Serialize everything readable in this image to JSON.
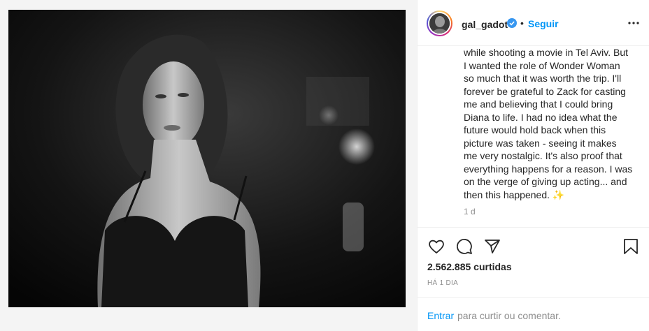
{
  "post": {
    "image_alt_icon": "portrait-photo",
    "username": "gal_gadot",
    "verified_icon": "verified-badge-icon",
    "separator": "•",
    "follow_label": "Seguir",
    "more_icon": "more-options-icon",
    "caption_lines": [
      "while shooting a movie in Tel Aviv. But",
      "I wanted the role of Wonder Woman",
      "so much that it was worth the trip. I'll",
      "forever be grateful to Zack for casting",
      "me and believing that I could bring",
      "Diana to life. I had no idea what the",
      "future would hold back when this",
      "picture was taken - seeing it makes",
      "me very nostalgic. It's also proof that",
      "everything happens for a reason. I was",
      "on the verge of giving up acting... and",
      "then this happened. ✨"
    ],
    "caption_time": "1 d",
    "likes": "2.562.885 curtidas",
    "posted_ago": "HÁ 1 DIA",
    "login_link": "Entrar",
    "login_rest": "para curtir ou comentar."
  },
  "colors": {
    "link_blue": "#0095f6",
    "text": "#262626",
    "muted": "#8e8e8e",
    "border": "#efefef"
  }
}
